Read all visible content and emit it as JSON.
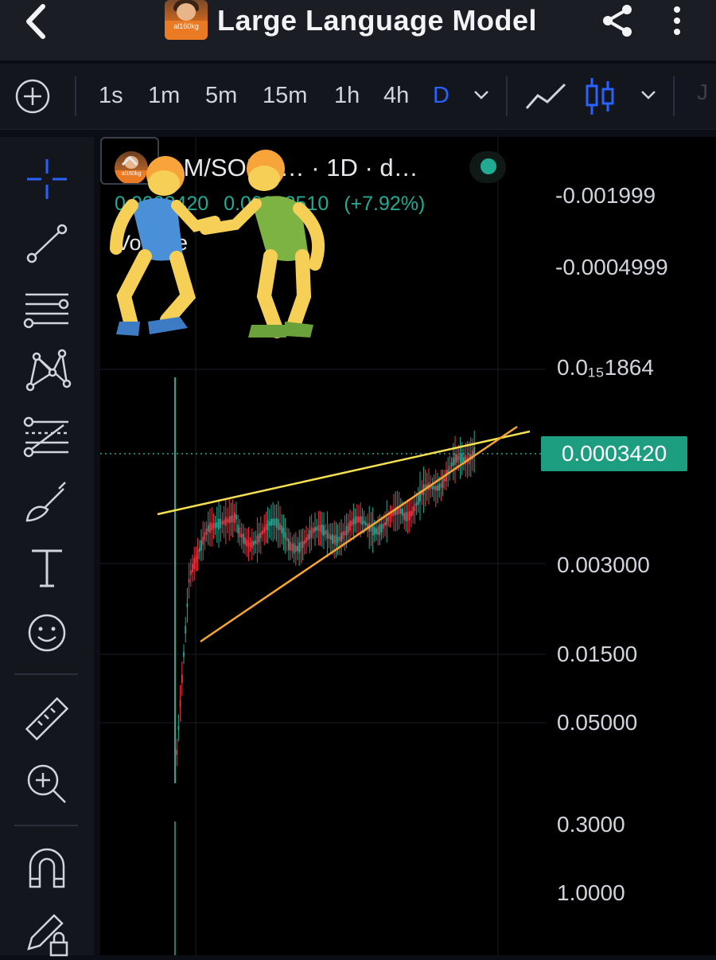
{
  "header": {
    "title": "Large Language Model",
    "avatar_label": "al160kg"
  },
  "toolbar": {
    "timeframes": [
      {
        "label": "1s",
        "active": false
      },
      {
        "label": "1m",
        "active": false
      },
      {
        "label": "5m",
        "active": false
      },
      {
        "label": "15m",
        "active": false
      },
      {
        "label": "1h",
        "active": false
      },
      {
        "label": "4h",
        "active": false
      },
      {
        "label": "D",
        "active": true
      }
    ],
    "partial_label": "J"
  },
  "sidebar": {
    "tools": [
      "crosshair-icon",
      "trend-line-icon",
      "horizontal-lines-icon",
      "pattern-icon",
      "fib-icon",
      "brush-icon",
      "text-icon",
      "emoji-icon",
      "ruler-icon",
      "zoom-in-icon",
      "magnet-icon",
      "lock-drawings-icon"
    ]
  },
  "chart": {
    "symbol": "LLM/SOL o…  · 1D · d…",
    "price": "0.0003420",
    "change": "0.00002510",
    "change_pct": "(+7.92%)",
    "volume_label": "Volume",
    "y_axis_labels": [
      {
        "text": "-0.001999"
      },
      {
        "text": "-0.0004999"
      },
      {
        "text": "0.0₁₅1864"
      },
      {
        "text": "0.003000"
      },
      {
        "text": "0.01500"
      },
      {
        "text": "0.05000"
      },
      {
        "text": "0.3000"
      },
      {
        "text": "1.0000"
      }
    ],
    "last_price_tag": "0.0003420",
    "colors": {
      "up": "#22ab94",
      "down": "#f23645",
      "resistance": "#f5e050",
      "support": "#f7a531"
    }
  },
  "chart_data": {
    "type": "candlestick",
    "title": "LLM/SOL o… · 1D · d…",
    "last_price": 0.000342,
    "change": 2.51e-05,
    "change_pct": 7.92,
    "y_tick_labels": [
      "-0.001999",
      "-0.0004999",
      "0.0₁₅1864",
      "0.0003420",
      "0.003000",
      "0.01500",
      "0.05000",
      "0.3000",
      "1.0000"
    ],
    "annotations": [
      "resistance trendline (yellow)",
      "support trendline (orange)",
      "last price dotted line"
    ],
    "overlay": "two wrestlers emoji"
  }
}
